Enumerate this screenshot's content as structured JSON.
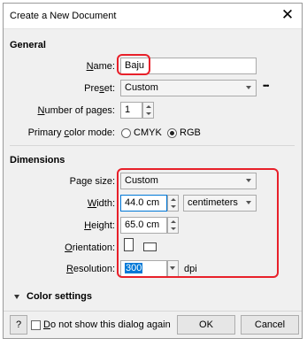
{
  "dialog": {
    "title": "Create a New Document",
    "close_glyph": "✕"
  },
  "general": {
    "heading": "General",
    "name": {
      "label_pre": "",
      "label_ul": "N",
      "label_post": "ame:",
      "value": "Baju"
    },
    "preset": {
      "label_pre": "Pre",
      "label_ul": "s",
      "label_post": "et:",
      "value": "Custom",
      "more": "•••"
    },
    "pages": {
      "label_pre": "",
      "label_ul": "N",
      "label_post": "umber of pages:",
      "value": "1"
    },
    "color_mode": {
      "label_pre": "Primary ",
      "label_ul": "c",
      "label_post": "olor mode:",
      "options": [
        {
          "label": "CMYK",
          "selected": false
        },
        {
          "label": "RGB",
          "selected": true
        }
      ]
    }
  },
  "dimensions": {
    "heading": "Dimensions",
    "page_size": {
      "label_pre": "Pa",
      "label_ul": "g",
      "label_post": "e size:",
      "value": "Custom"
    },
    "width": {
      "label_pre": "",
      "label_ul": "W",
      "label_post": "idth:",
      "value": "44.0 cm",
      "unit": "centimeters"
    },
    "height": {
      "label_pre": "",
      "label_ul": "H",
      "label_post": "eight:",
      "value": "65.0 cm"
    },
    "orientation": {
      "label_pre": "",
      "label_ul": "O",
      "label_post": "rientation:"
    },
    "resolution": {
      "label_pre": "",
      "label_ul": "R",
      "label_post": "esolution:",
      "value": "300",
      "unit": "dpi"
    }
  },
  "color_settings": {
    "label": "Color settings",
    "collapsed": true
  },
  "footer": {
    "help": "?",
    "dont_show_pre": "",
    "dont_show_ul": "D",
    "dont_show_post": "o not show this dialog again",
    "ok": "OK",
    "cancel": "Cancel"
  },
  "colors": {
    "highlight": "#e8202a",
    "selection": "#0078d7"
  }
}
